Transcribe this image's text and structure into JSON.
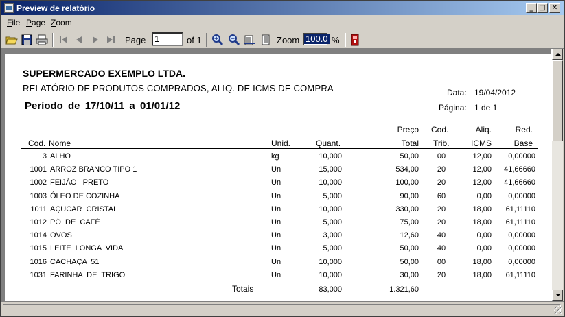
{
  "window": {
    "title": "Preview de relatório",
    "minimize_glyph": "_",
    "maximize_glyph": "□",
    "close_glyph": "✕"
  },
  "menu": [
    {
      "label": "File"
    },
    {
      "label": "Page"
    },
    {
      "label": "Zoom"
    }
  ],
  "toolbar": {
    "page_label": "Page",
    "page_value": "1",
    "of_label": "of 1",
    "zoom_label": "Zoom",
    "zoom_value": "100.0",
    "percent_label": "%",
    "icons": [
      "open-icon",
      "save-icon",
      "print-icon",
      "first-page-icon",
      "prev-page-icon",
      "next-page-icon",
      "last-page-icon",
      "zoom-in-icon",
      "zoom-out-icon",
      "fit-width-icon",
      "whole-page-icon",
      "exit-icon"
    ]
  },
  "report": {
    "company": "SUPERMERCADO EXEMPLO LTDA.",
    "subtitle": "RELATÓRIO DE PRODUTOS COMPRADOS, ALIQ. DE ICMS DE COMPRA",
    "period_label": "Período de",
    "period_from": "17/10/11",
    "period_sep": "a",
    "period_to": "01/01/12",
    "date_label": "Data:",
    "date_value": "19/04/2012",
    "page_label": "Página:",
    "page_value": "1 de 1",
    "columns": {
      "cod": "Cod.",
      "nome": "Nome",
      "unid": "Unid.",
      "quant": "Quant.",
      "preco_top": "Preço",
      "preco_bottom": "Total",
      "codtrib_top": "Cod.",
      "codtrib_bottom": "Trib.",
      "aliq_top": "Aliq.",
      "aliq_bottom": "ICMS",
      "red_top": "Red.",
      "red_bottom": "Base"
    },
    "rows": [
      {
        "cod": "3",
        "nome": "ALHO",
        "unid": "kg",
        "quant": "10,000",
        "preco": "50,00",
        "trib": "00",
        "aliq": "12,00",
        "red": "0,00000"
      },
      {
        "cod": "1001",
        "nome": "ARROZ BRANCO TIPO 1",
        "unid": "Un",
        "quant": "15,000",
        "preco": "534,00",
        "trib": "20",
        "aliq": "12,00",
        "red": "41,66660"
      },
      {
        "cod": "1002",
        "nome": "FEIJÃO   PRETO",
        "unid": "Un",
        "quant": "10,000",
        "preco": "100,00",
        "trib": "20",
        "aliq": "12,00",
        "red": "41,66660"
      },
      {
        "cod": "1003",
        "nome": "ÓLEO DE COZINHA",
        "unid": "Un",
        "quant": "5,000",
        "preco": "90,00",
        "trib": "60",
        "aliq": "0,00",
        "red": "0,00000"
      },
      {
        "cod": "1011",
        "nome": "AÇUCAR  CRISTAL",
        "unid": "Un",
        "quant": "10,000",
        "preco": "330,00",
        "trib": "20",
        "aliq": "18,00",
        "red": "61,11110"
      },
      {
        "cod": "1012",
        "nome": "PÓ  DE  CAFÉ",
        "unid": "Un",
        "quant": "5,000",
        "preco": "75,00",
        "trib": "20",
        "aliq": "18,00",
        "red": "61,11110"
      },
      {
        "cod": "1014",
        "nome": "OVOS",
        "unid": "Un",
        "quant": "3,000",
        "preco": "12,60",
        "trib": "40",
        "aliq": "0,00",
        "red": "0,00000"
      },
      {
        "cod": "1015",
        "nome": "LEITE  LONGA  VIDA",
        "unid": "Un",
        "quant": "5,000",
        "preco": "50,00",
        "trib": "40",
        "aliq": "0,00",
        "red": "0,00000"
      },
      {
        "cod": "1016",
        "nome": "CACHAÇA  51",
        "unid": "Un",
        "quant": "10,000",
        "preco": "50,00",
        "trib": "00",
        "aliq": "18,00",
        "red": "0,00000"
      },
      {
        "cod": "1031",
        "nome": "FARINHA  DE  TRIGO",
        "unid": "Un",
        "quant": "10,000",
        "preco": "30,00",
        "trib": "20",
        "aliq": "18,00",
        "red": "61,11110"
      }
    ],
    "totals": {
      "label": "Totais",
      "quant": "83,000",
      "preco": "1.321,60"
    }
  }
}
